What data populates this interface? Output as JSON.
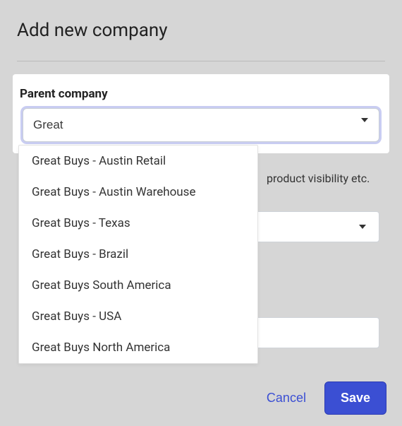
{
  "header": {
    "title": "Add new company"
  },
  "parentCompany": {
    "label": "Parent company",
    "inputValue": "Great",
    "options": [
      "Great Buys - Austin Retail",
      "Great Buys - Austin Warehouse",
      "Great Buys - Texas",
      "Great Buys - Brazil",
      "Great Buys South America",
      "Great Buys - USA",
      "Great Buys North America"
    ]
  },
  "partialText": "  product visibility etc.",
  "buttons": {
    "cancel": "Cancel",
    "save": "Save"
  }
}
